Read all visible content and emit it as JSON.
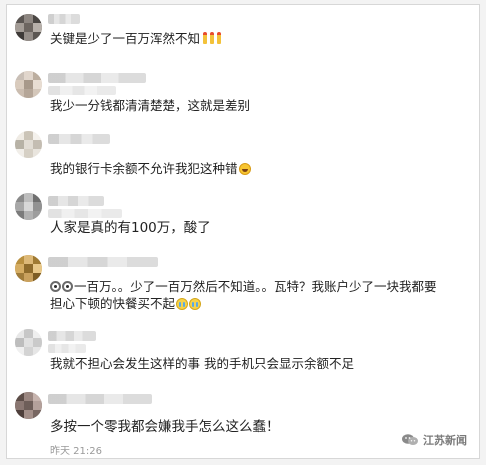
{
  "comments": [
    {
      "text": "关键是少了一百万浑然不知",
      "emojis": [
        "candle-emoji",
        "candle-emoji",
        "candle-emoji"
      ]
    },
    {
      "text": "我少一分钱都清清楚楚，这就是差别"
    },
    {
      "text": "我的银行卡余额不允许我犯这种错",
      "emojis": [
        "laugh-cry-emoji"
      ]
    },
    {
      "text": "人家是真的有100万，酸了"
    },
    {
      "text_line1": "一百万。。少了一百万然后不知道。。瓦特？我账户少了一块我都要",
      "text_line2": "担心下顿的快餐买不起",
      "emojis": [
        "shocked-eyes-emoji",
        "shocked-eyes-emoji",
        "crying-emoji",
        "crying-emoji"
      ]
    },
    {
      "text": "我就不担心会发生这样的事 我的手机只会显示余额不足"
    },
    {
      "text": "多按一个零我都会嫌我手怎么这么蠢！",
      "time": "昨天 21:26"
    }
  ],
  "watermark": {
    "text": "江苏新闻",
    "icon": "wechat-icon"
  },
  "colors": {
    "text": "#222222",
    "time": "#9a9a9a",
    "background": "#ffffff",
    "page": "#f3f3f3"
  }
}
